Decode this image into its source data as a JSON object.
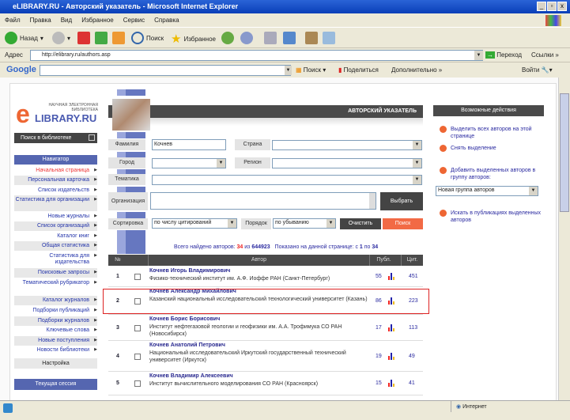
{
  "window": {
    "title": "eLIBRARY.RU - Авторский указатель - Microsoft Internet Explorer"
  },
  "menu": [
    "Файл",
    "Правка",
    "Вид",
    "Избранное",
    "Сервис",
    "Справка"
  ],
  "toolbar": {
    "back": "Назад",
    "search": "Поиск",
    "favorites": "Избранное"
  },
  "address": {
    "label": "Адрес",
    "url": "http://elibrary.ru/authors.asp",
    "go": "Переход",
    "links": "Ссылки »"
  },
  "google": {
    "logo": "Google",
    "search": "Поиск",
    "share": "Поделиться",
    "more": "Дополнительно »",
    "login": "Войти"
  },
  "logo": {
    "tagline1": "НАУЧНАЯ ЭЛЕКТРОННАЯ",
    "tagline2": "БИБЛИОТЕКА",
    "brand": "LIBRARY.RU"
  },
  "sidebar": {
    "search_library": "Поиск в библиотеке",
    "navigator": "Навигатор",
    "items": [
      "Начальная страница",
      "Персональная карточка",
      "Список издательств",
      "Статистика для организации",
      "Новые журналы",
      "Список организаций",
      "Каталог книг",
      "Общая статистика",
      "Статистика для издательства",
      "Поисковые запросы",
      "Тематический рубрикатор",
      "Каталог журналов",
      "Подборки публикаций",
      "Подборки журналов",
      "Ключевые слова",
      "Новые поступления",
      "Новости библиотеки"
    ],
    "settings": "Настройка",
    "session": "Текущая сессия"
  },
  "main": {
    "header": "АВТОРСКИЙ УКАЗАТЕЛЬ",
    "form": {
      "surname_label": "Фамилия",
      "surname_value": "Кочнев",
      "country_label": "Страна",
      "city_label": "Город",
      "region_label": "Регион",
      "topic_label": "Тематика",
      "org_label": "Организация",
      "choose": "Выбрать",
      "sort_label": "Сортировка",
      "sort_value": "по числу цитирований",
      "order_label": "Порядок",
      "order_value": "по убыванию",
      "clear": "Очистить",
      "search": "Поиск"
    },
    "summary": {
      "prefix": "Всего найдено авторов: ",
      "found": "34",
      "mid": " из ",
      "total": "644923",
      ".": ".",
      "shown": "Показано на данной странице: с ",
      "from": "1",
      "to_word": " по ",
      "to": "34"
    },
    "table": {
      "headers": [
        "№",
        "",
        "Автор",
        "Публ.",
        "Цит."
      ],
      "rows": [
        {
          "n": "1",
          "name": "Кочнев Игорь Владимирович",
          "org": "Физико-технический институт им. А.Ф. Иоффе РАН (Санкт-Петербург)",
          "pub": "55",
          "cit": "451"
        },
        {
          "n": "2",
          "name": "Кочнев Александр Михайлович",
          "org": "Казанский национальный исследовательский технологический университет (Казань)",
          "pub": "86",
          "cit": "223"
        },
        {
          "n": "3",
          "name": "Кочнев Борис Борисович",
          "org": "Институт нефтегазовой геологии и геофизики им. А.А. Трофимука СО РАН (Новосибирск)",
          "pub": "17",
          "cit": "113"
        },
        {
          "n": "4",
          "name": "Кочнев Анатолий Петрович",
          "org": "Национальный исследовательский Иркутский государственный технический университет (Иркутск)",
          "pub": "19",
          "cit": "49"
        },
        {
          "n": "5",
          "name": "Кочнев Владимир Алексеевич",
          "org": "Институт вычислительного моделирования СО РАН (Красноярск)",
          "pub": "15",
          "cit": "41"
        }
      ]
    }
  },
  "actions": {
    "header": "Возможные действия",
    "select_all": "Выделить всех авторов на этой странице",
    "deselect": "Снять выделение",
    "add_group": "Добавить выделенных авторов в группу авторов:",
    "group_value": "Новая группа авторов",
    "search_pubs": "Искать в публикациях выделенных авторов"
  },
  "status": {
    "zone": "Интернет"
  },
  "colors": {
    "accent": "#ee6633",
    "nav": "#5566b0",
    "header": "#4a4a4a",
    "highlight": "#dd2222"
  }
}
